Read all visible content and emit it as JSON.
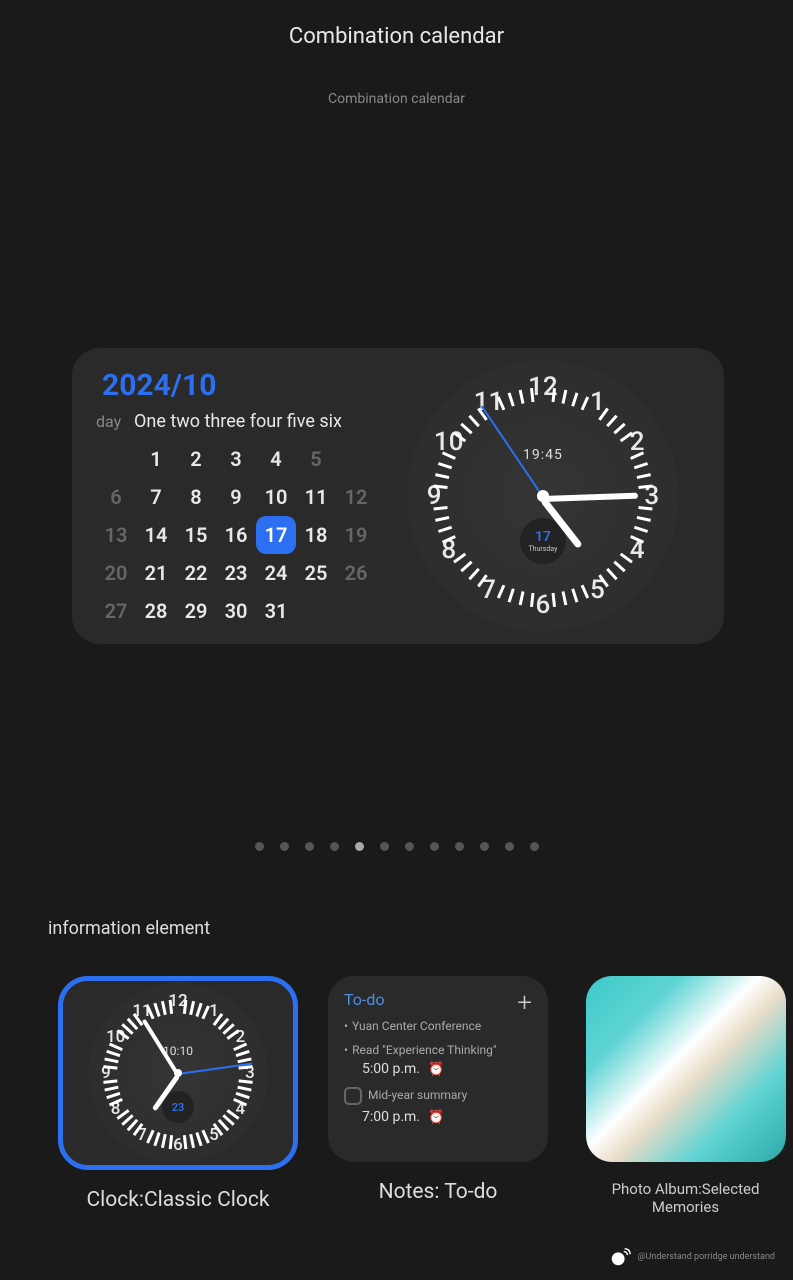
{
  "header": {
    "main_title": "Combination calendar",
    "sub_title": "Combination calendar"
  },
  "calendar": {
    "year_month": "2024/10",
    "day_label": "day",
    "weekday_header": "One two three four five six",
    "grid": [
      {
        "v": "",
        "dim": true
      },
      {
        "v": "1",
        "dim": false
      },
      {
        "v": "2",
        "dim": false
      },
      {
        "v": "3",
        "dim": false
      },
      {
        "v": "4",
        "dim": false
      },
      {
        "v": "5",
        "dim": true
      },
      {
        "v": "",
        "dim": true
      },
      {
        "v": "6",
        "dim": true
      },
      {
        "v": "7",
        "dim": false
      },
      {
        "v": "8",
        "dim": false
      },
      {
        "v": "9",
        "dim": false
      },
      {
        "v": "10",
        "dim": false
      },
      {
        "v": "11",
        "dim": false
      },
      {
        "v": "12",
        "dim": true
      },
      {
        "v": "13",
        "dim": true
      },
      {
        "v": "14",
        "dim": false
      },
      {
        "v": "15",
        "dim": false
      },
      {
        "v": "16",
        "dim": false
      },
      {
        "v": "17",
        "dim": false,
        "selected": true
      },
      {
        "v": "18",
        "dim": false
      },
      {
        "v": "19",
        "dim": true
      },
      {
        "v": "20",
        "dim": true
      },
      {
        "v": "21",
        "dim": false
      },
      {
        "v": "22",
        "dim": false
      },
      {
        "v": "23",
        "dim": false
      },
      {
        "v": "24",
        "dim": false
      },
      {
        "v": "25",
        "dim": false
      },
      {
        "v": "26",
        "dim": true
      },
      {
        "v": "27",
        "dim": true
      },
      {
        "v": "28",
        "dim": false
      },
      {
        "v": "29",
        "dim": false
      },
      {
        "v": "30",
        "dim": false
      },
      {
        "v": "31",
        "dim": false
      },
      {
        "v": "",
        "dim": true
      },
      {
        "v": "",
        "dim": true
      }
    ]
  },
  "clock": {
    "digital": "19:45",
    "date_num": "17",
    "date_day": "Thursday",
    "numbers": [
      "1",
      "2",
      "3",
      "4",
      "5",
      "6",
      "7",
      "8",
      "9",
      "10",
      "11",
      "12"
    ],
    "hour_angle": 142,
    "min_angle": 88,
    "sec_angle": 326
  },
  "pager": {
    "count": 12,
    "active": 4
  },
  "section": {
    "title": "information element"
  },
  "thumbs": {
    "clock": {
      "label": "Clock:Classic Clock",
      "digital": "10:10",
      "date_num": "23",
      "numbers": [
        "1",
        "2",
        "3",
        "4",
        "5",
        "6",
        "7",
        "8",
        "9",
        "10",
        "11",
        "12"
      ],
      "hour_angle": 215,
      "min_angle": 328,
      "sec_angle": 82
    },
    "notes": {
      "label": "Notes: To-do",
      "header": "To-do",
      "items": [
        {
          "title": "Yuan Center Conference",
          "time": "",
          "checkbox": false,
          "bullet": true
        },
        {
          "title": "Read \"Experience Thinking\"",
          "time": "5:00 p.m.",
          "alarm": "white",
          "checkbox": false,
          "bullet": true
        },
        {
          "title": "Mid-year summary",
          "time": "7:00 p.m.",
          "alarm": "orange",
          "checkbox": true,
          "bullet": false
        }
      ]
    },
    "photo": {
      "label": "Photo Album:Selected Memories"
    }
  },
  "watermark": {
    "text": "@Understand porridge understand"
  }
}
